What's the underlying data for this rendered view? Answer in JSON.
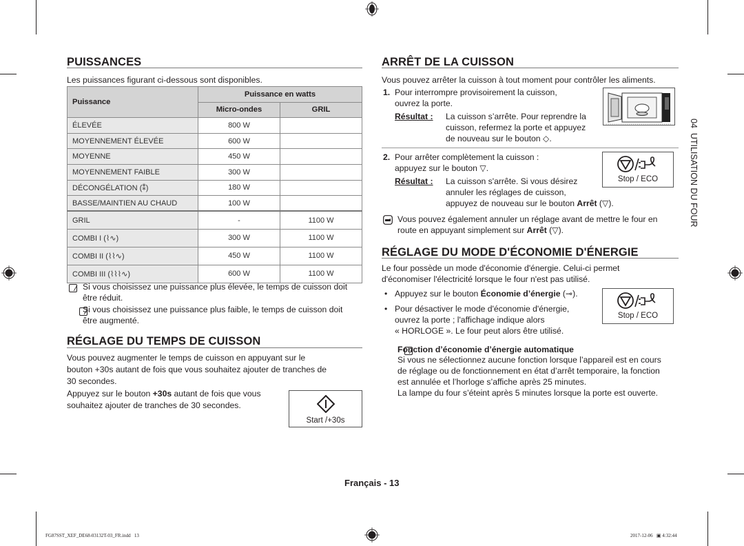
{
  "puissances": {
    "title": "PUISSANCES",
    "intro": "Les puissances figurant ci-dessous sont disponibles.",
    "table": {
      "col_puissance": "Puissance",
      "col_group": "Puissance en watts",
      "col_micro": "Micro-ondes",
      "col_gril": "GRIL",
      "rows": [
        {
          "name": "ÉLEVÉE",
          "micro": "800 W",
          "gril": ""
        },
        {
          "name": "MOYENNEMENT ÉLEVÉE",
          "micro": "600 W",
          "gril": ""
        },
        {
          "name": "MOYENNE",
          "micro": "450 W",
          "gril": ""
        },
        {
          "name": "MOYENNEMENT FAIBLE",
          "micro": "300 W",
          "gril": ""
        },
        {
          "name": "DÉCONGÉLATION (⁑)",
          "micro": "180 W",
          "gril": ""
        },
        {
          "name": "BASSE/MAINTIEN AU CHAUD",
          "micro": "100 W",
          "gril": ""
        },
        {
          "name": "GRIL",
          "micro": "-",
          "gril": "1100 W"
        },
        {
          "name": "COMBI I (⌇∿)",
          "micro": "300 W",
          "gril": "1100 W"
        },
        {
          "name": "COMBI II (⌇⌇∿)",
          "micro": "450 W",
          "gril": "1100 W"
        },
        {
          "name": "COMBI III (⌇⌇⌇∿)",
          "micro": "600 W",
          "gril": "1100 W"
        }
      ]
    },
    "notes": [
      {
        "line1": "Si vous choisissez une puissance plus élevée, le temps de cuisson doit",
        "line2": "être réduit."
      },
      {
        "line1": "Si vous choisissez une puissance plus faible, le temps de cuisson doit",
        "line2": "être augmenté."
      }
    ]
  },
  "temps": {
    "title": "RÉGLAGE DU TEMPS DE CUISSON",
    "para1": [
      "Vous pouvez augmenter le temps de cuisson en appuyant sur le",
      "bouton +30s autant de fois que vous souhaitez ajouter de tranches de",
      "30 secondes."
    ],
    "para2_pre": "Appuyez sur le bouton ",
    "para2_bold": "+30s",
    "para2_post": " autant de fois que vous",
    "para2_line2": "souhaitez ajouter de tranches de 30 secondes.",
    "button_label": "Start /+30s"
  },
  "arret": {
    "title": "ARRÊT DE LA CUISSON",
    "intro": "Vous pouvez arrêter la cuisson à tout moment pour contrôler les aliments.",
    "step1_num": "1.",
    "step1": [
      "Pour interrompre provisoirement la cuisson,",
      "ouvrez la porte."
    ],
    "result_label": "Résultat :",
    "step1_result": [
      "La cuisson s’arrête. Pour reprendre la",
      "cuisson, refermez la porte et appuyez",
      "de nouveau sur le bouton ◇."
    ],
    "step2_num": "2.",
    "step2": [
      "Pour arrêter complètement la cuisson :",
      "appuyez sur le bouton ▽."
    ],
    "step2_result": [
      "La cuisson s'arrête. Si vous désirez",
      "annuler les réglages de cuisson,"
    ],
    "step2_result_line3_pre": "appuyez de nouveau sur le bouton ",
    "step2_result_line3_bold": "Arrêt",
    "step2_result_line3_post": " (▽).",
    "tip_line1": "Vous pouvez également annuler un réglage avant de mettre le four en",
    "tip_line2_pre": "route en appuyant simplement sur ",
    "tip_line2_bold": "Arrêt",
    "tip_line2_post": " (▽).",
    "stop_button_label": "Stop / ECO"
  },
  "eco": {
    "title": "RÉGLAGE DU MODE D'ÉCONOMIE D'ÉNERGIE",
    "intro": [
      "Le four possède un mode d'économie d'énergie. Celui-ci permet",
      "d'économiser l'électricité lorsque le four n'est pas utilisé."
    ],
    "bullet1_pre": "Appuyez sur le bouton ",
    "bullet1_bold": "Économie d’énergie",
    "bullet1_post": " (⊸).",
    "bullet2": [
      "Pour désactiver le mode d'économie d'énergie,",
      "ouvrez la porte ; l'affichage indique alors",
      "« HORLOGE ». Le four peut alors être utilisé."
    ],
    "stop_button_label": "Stop / ECO",
    "auto_title": "Fonction d’économie d’énergie automatique",
    "auto_text": [
      "Si vous ne sélectionnez aucune fonction lorsque l’appareil est en cours",
      "de réglage ou de fonctionnement en état d’arrêt temporaire, la fonction",
      "est annulée et l’horloge s’affiche après 25 minutes.",
      "La lampe du four s’éteint après 5 minutes lorsque la porte est ouverte."
    ]
  },
  "side_tab": "04  UTILISATION DU FOUR",
  "page_footer": "Français - 13",
  "print_slug": "FG87SST_XEF_DE68-03132T-03_FR.indd   13",
  "print_date": "2017-12-06   ▣ 4:32:44"
}
